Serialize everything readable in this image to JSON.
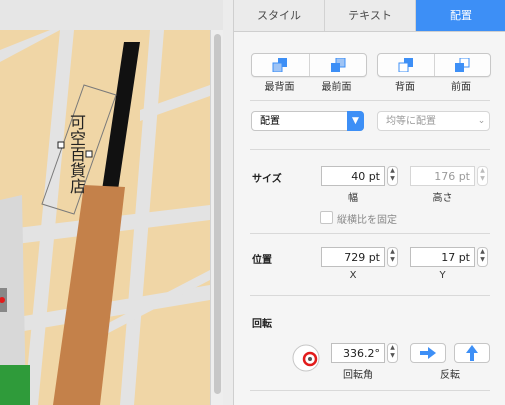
{
  "tabs": [
    {
      "label": "スタイル",
      "active": false
    },
    {
      "label": "テキスト",
      "active": false
    },
    {
      "label": "配置",
      "active": true
    }
  ],
  "shape_text": "可空百貨店",
  "arrange": {
    "back_label": "最背面",
    "front_label": "最前面",
    "backward_label": "背面",
    "forward_label": "前面"
  },
  "align_popup": {
    "value": "配置"
  },
  "distribute_popup": {
    "value": "均等に配置"
  },
  "size": {
    "title": "サイズ",
    "width_value": "40 pt",
    "width_label": "幅",
    "height_value": "176 pt",
    "height_label": "高さ",
    "constrain_label": "縦横比を固定"
  },
  "position": {
    "title": "位置",
    "x_value": "729 pt",
    "x_label": "X",
    "y_value": "17 pt",
    "y_label": "Y"
  },
  "rotate": {
    "title": "回転",
    "angle_value": "336.2°",
    "angle_label": "回転角",
    "flip_label": "反転"
  },
  "colors": {
    "accent": "#3d8ff6",
    "map_background": "#f0d6a6",
    "road": "#e3e3e3",
    "rail": "#111111",
    "building": "#c4814a",
    "highlight": "#e21b1b"
  },
  "icons": [
    "send-to-back-icon",
    "bring-to-front-icon",
    "send-backward-icon",
    "bring-forward-icon",
    "chevron-down-icon",
    "stepper-icon",
    "rotation-wheel-icon",
    "flip-horizontal-icon",
    "flip-vertical-icon"
  ]
}
